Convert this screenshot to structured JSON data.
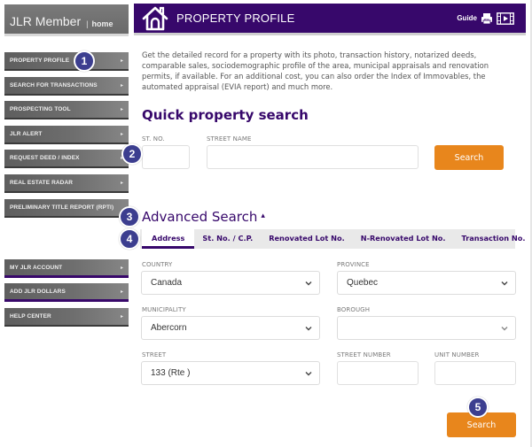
{
  "sidebar": {
    "member_title": "JLR Member",
    "separator": "|",
    "home_link": "home",
    "nav_items": [
      {
        "label": "PROPERTY PROFILE"
      },
      {
        "label": "SEARCH FOR TRANSACTIONS"
      },
      {
        "label": "PROSPECTING TOOL"
      },
      {
        "label": "JLR ALERT"
      },
      {
        "label": "REQUEST DEED / INDEX"
      },
      {
        "label": "REAL ESTATE RADAR"
      },
      {
        "label": "PRELIMINARY TITLE REPORT (RPTI)"
      }
    ],
    "account_items": [
      {
        "label": "MY JLR ACCOUNT"
      },
      {
        "label": "ADD JLR DOLLARS"
      },
      {
        "label": "HELP CENTER"
      }
    ],
    "arrow_glyph": "▸"
  },
  "header": {
    "title": "PROPERTY PROFILE",
    "guide_label": "Guide",
    "icons": [
      "home-icon",
      "pdf-icon",
      "video-icon"
    ]
  },
  "intro_text": "Get the detailed record for a property with its photo, transaction history, notarized deeds, comparable sales, sociodemographic profile of the area, municipal appraisals and renovation permits, if available. For an additional cost, you can also order the Index of Immovables, the automated appraisal (EVIA report) and much more.",
  "quick_search": {
    "title": "Quick property search",
    "st_no_label": "ST. NO.",
    "st_no_value": "",
    "street_name_label": "STREET NAME",
    "street_name_value": "",
    "search_button": "Search"
  },
  "advanced_search": {
    "title": "Advanced Search",
    "toggle_glyph": "⌃",
    "tabs": [
      {
        "label": "Address",
        "active": true
      },
      {
        "label": "St. No. / C.P.",
        "active": false
      },
      {
        "label": "Renovated Lot No.",
        "active": false
      },
      {
        "label": "N-Renovated Lot No.",
        "active": false
      },
      {
        "label": "Transaction No.",
        "active": false
      }
    ],
    "fields": {
      "country": {
        "label": "COUNTRY",
        "value": "Canada"
      },
      "province": {
        "label": "PROVINCE",
        "value": "Quebec"
      },
      "municipality": {
        "label": "MUNICIPALITY",
        "value": "Abercorn"
      },
      "borough": {
        "label": "BOROUGH",
        "value": ""
      },
      "street": {
        "label": "STREET",
        "value": "133 (Rte )"
      },
      "street_number": {
        "label": "STREET NUMBER",
        "value": ""
      },
      "unit_number": {
        "label": "UNIT NUMBER",
        "value": ""
      }
    },
    "search_button": "Search"
  },
  "markers": [
    "1",
    "2",
    "3",
    "4",
    "5"
  ],
  "colors": {
    "brand_purple": "#37086b",
    "accent_orange": "#e8861c",
    "marker_blue": "#3c3e8f",
    "sidebar_gray": "#6e6e6e",
    "tab_bg": "#e9e9e9"
  }
}
